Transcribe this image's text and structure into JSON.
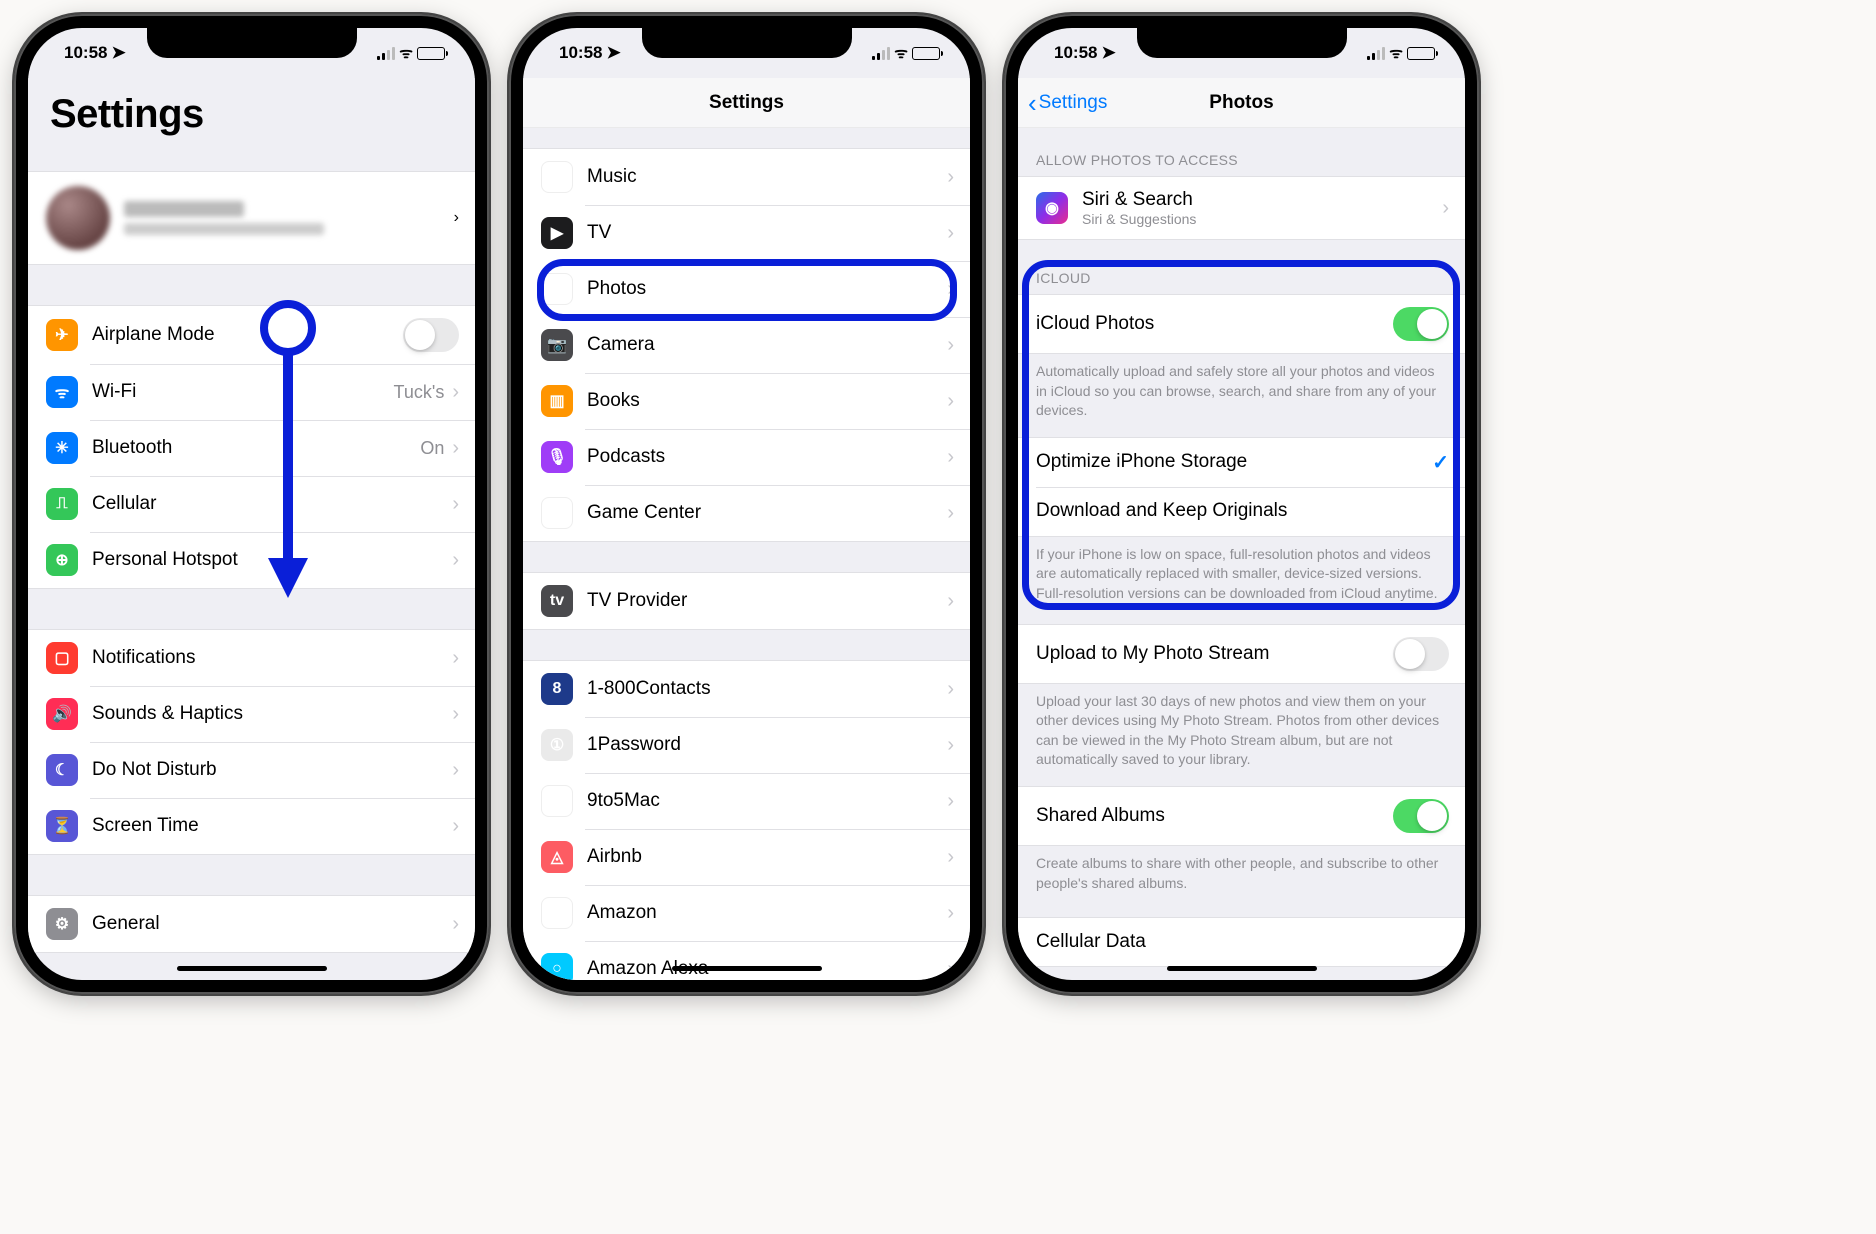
{
  "status": {
    "time": "10:58",
    "location_icon": "➤",
    "wifi_icon": "ᯤ"
  },
  "phone1": {
    "title": "Settings",
    "rows1": [
      {
        "icon": "✈",
        "iconClass": "ic-orange",
        "label": "Airplane Mode",
        "type": "toggle",
        "on": false
      },
      {
        "icon": "ᯤ",
        "iconClass": "ic-blue",
        "label": "Wi-Fi",
        "detail": "Tuck's",
        "type": "link"
      },
      {
        "icon": "✳",
        "iconClass": "ic-blue",
        "label": "Bluetooth",
        "detail": "On",
        "type": "link"
      },
      {
        "icon": "⎍",
        "iconClass": "ic-green",
        "label": "Cellular",
        "type": "link"
      },
      {
        "icon": "⊕",
        "iconClass": "ic-green",
        "label": "Personal Hotspot",
        "type": "link"
      }
    ],
    "rows2": [
      {
        "icon": "▢",
        "iconClass": "ic-red",
        "label": "Notifications",
        "type": "link"
      },
      {
        "icon": "🔊",
        "iconClass": "ic-pink",
        "label": "Sounds & Haptics",
        "type": "link"
      },
      {
        "icon": "☾",
        "iconClass": "ic-purple",
        "label": "Do Not Disturb",
        "type": "link"
      },
      {
        "icon": "⏳",
        "iconClass": "ic-purple",
        "label": "Screen Time",
        "type": "link"
      }
    ],
    "rows3": [
      {
        "icon": "⚙",
        "iconClass": "ic-gray",
        "label": "General",
        "type": "link"
      }
    ]
  },
  "phone2": {
    "title": "Settings",
    "rows1": [
      {
        "icon": "♫",
        "iconClass": "ic-white",
        "label": "Music"
      },
      {
        "icon": "▶",
        "iconClass": "ic-black",
        "label": "TV"
      },
      {
        "icon": "❀",
        "iconClass": "ic-white",
        "label": "Photos"
      },
      {
        "icon": "📷",
        "iconClass": "ic-darkgray",
        "label": "Camera"
      },
      {
        "icon": "▥",
        "iconClass": "ic-bookorange",
        "label": "Books"
      },
      {
        "icon": "🎙",
        "iconClass": "ic-podpurple",
        "label": "Podcasts"
      },
      {
        "icon": "◑",
        "iconClass": "ic-gc",
        "label": "Game Center"
      }
    ],
    "rows2": [
      {
        "icon": "tv",
        "iconClass": "ic-darkgray",
        "label": "TV Provider"
      }
    ],
    "rows3": [
      {
        "icon": "8",
        "iconClass": "ic-contacts",
        "label": "1-800Contacts"
      },
      {
        "icon": "①",
        "iconClass": "ic-1pass",
        "label": "1Password"
      },
      {
        "icon": "◔",
        "iconClass": "ic-9to5",
        "label": "9to5Mac"
      },
      {
        "icon": "◬",
        "iconClass": "ic-airbnb",
        "label": "Airbnb"
      },
      {
        "icon": "amz",
        "iconClass": "ic-amazon",
        "label": "Amazon"
      },
      {
        "icon": "○",
        "iconClass": "ic-alexa",
        "label": "Amazon Alexa"
      }
    ]
  },
  "phone3": {
    "back": "Settings",
    "title": "Photos",
    "access_header": "ALLOW PHOTOS TO ACCESS",
    "siri": {
      "title": "Siri & Search",
      "subtitle": "Siri & Suggestions"
    },
    "icloud_header": "ICLOUD",
    "icloud_photos": "iCloud Photos",
    "icloud_footer": "Automatically upload and safely store all your photos and videos in iCloud so you can browse, search, and share from any of your devices.",
    "optimize": "Optimize iPhone Storage",
    "download": "Download and Keep Originals",
    "storage_footer": "If your iPhone is low on space, full-resolution photos and videos are automatically replaced with smaller, device-sized versions. Full-resolution versions can be downloaded from iCloud anytime.",
    "upload_stream": "Upload to My Photo Stream",
    "upload_footer": "Upload your last 30 days of new photos and view them on your other devices using My Photo Stream. Photos from other devices can be viewed in the My Photo Stream album, but are not automatically saved to your library.",
    "shared": "Shared Albums",
    "shared_footer": "Create albums to share with other people, and subscribe to other people's shared albums.",
    "cellular": "Cellular Data"
  }
}
